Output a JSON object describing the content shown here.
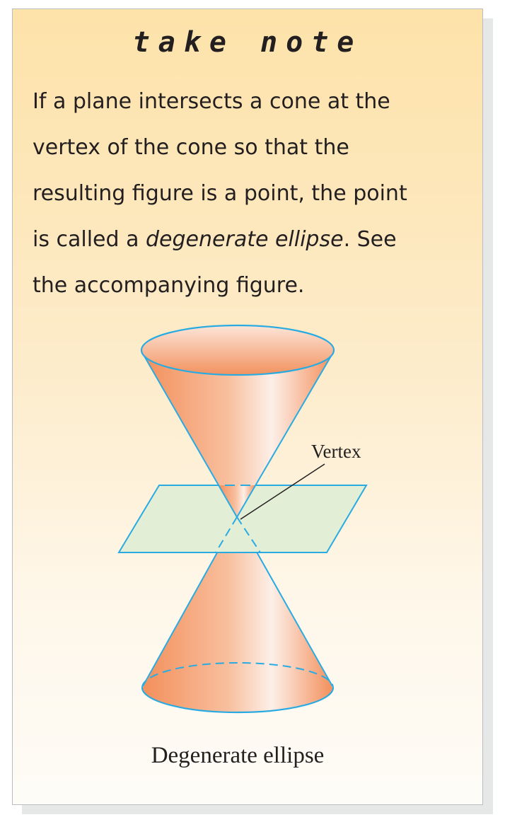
{
  "note": {
    "title": "take note",
    "lines": [
      {
        "text": "If a plane intersects a cone at the"
      },
      {
        "text": "vertex of the cone so that the"
      },
      {
        "text": "resulting figure is a point, the point"
      },
      {
        "pre": "is called a ",
        "em": "degenerate ellipse",
        "post": ". See"
      },
      {
        "text": "the accompanying figure."
      }
    ]
  },
  "figure": {
    "vertex_label": "Vertex",
    "caption": "Degenerate ellipse",
    "colors": {
      "cone": "#f3915f",
      "outline": "#29abe2",
      "plane": "#e3eed6",
      "background_top": "#fde2a9"
    }
  }
}
